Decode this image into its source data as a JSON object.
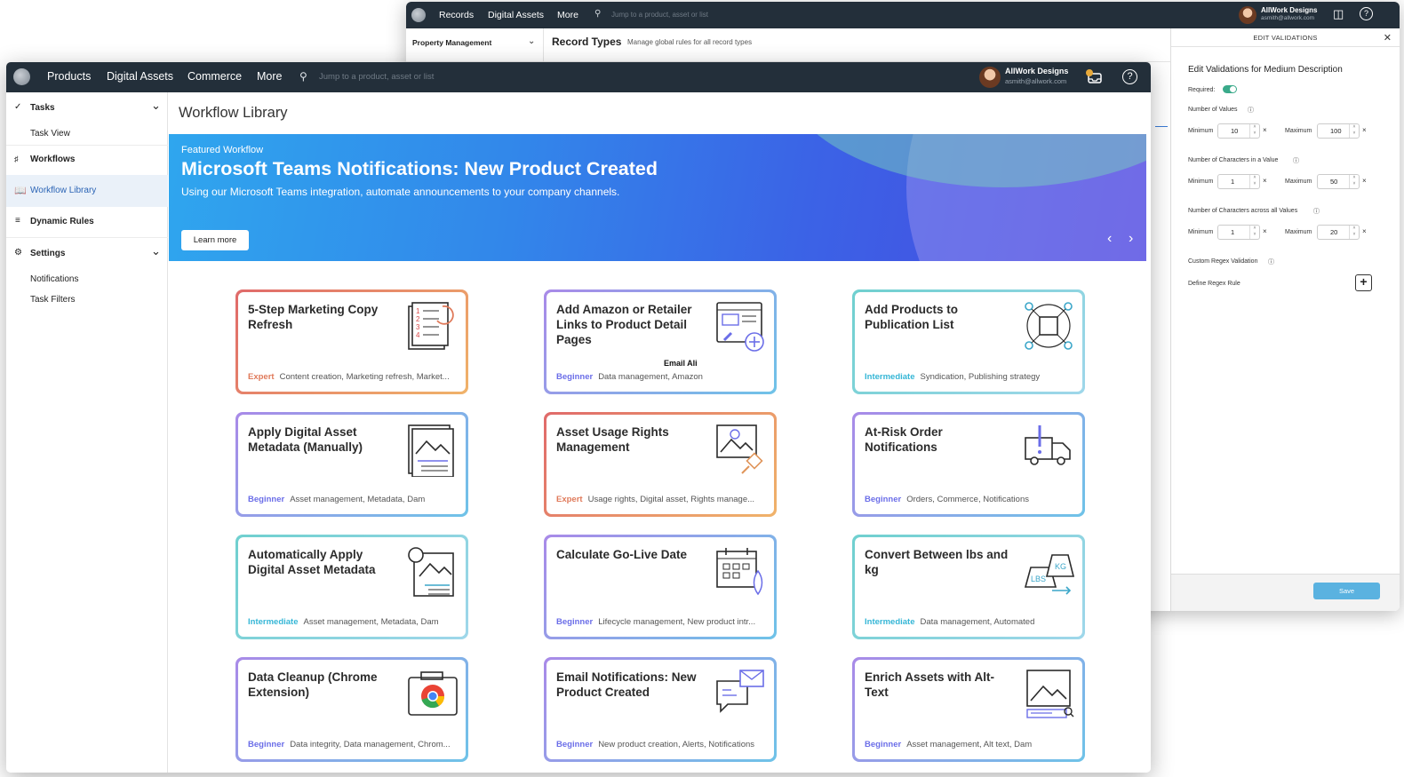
{
  "back_window": {
    "nav": {
      "records": "Records",
      "digital_assets": "Digital Assets",
      "more": "More",
      "search_placeholder": "Jump to a product, asset or list"
    },
    "user": {
      "name": "AllWork Designs",
      "email": "asmith@allwork.com"
    },
    "dropdown": "Property Management",
    "page_title": "Record Types",
    "page_subtitle": "Manage global rules for all record types",
    "panel": {
      "header": "EDIT VALIDATIONS",
      "title": "Edit Validations for Medium Description",
      "required_label": "Required:",
      "sections": [
        {
          "label": "Number of Values",
          "min_label": "Minimum",
          "min": "10",
          "max_label": "Maximum",
          "max": "100"
        },
        {
          "label": "Number of Characters in a Value",
          "min_label": "Minimum",
          "min": "1",
          "max_label": "Maximum",
          "max": "50"
        },
        {
          "label": "Number of Characters across all Values",
          "min_label": "Minimum",
          "min": "1",
          "max_label": "Maximum",
          "max": "20"
        }
      ],
      "custom_regex": "Custom Regex Validation",
      "define_rule": "Define Regex Rule",
      "save": "Save"
    }
  },
  "front_window": {
    "nav": {
      "products": "Products",
      "digital_assets": "Digital Assets",
      "commerce": "Commerce",
      "more": "More",
      "search_placeholder": "Jump to a product, asset or list"
    },
    "user": {
      "name": "AllWork Designs",
      "email": "asmith@allwork.com"
    },
    "sidebar": {
      "tasks": "Tasks",
      "task_view": "Task View",
      "workflows": "Workflows",
      "workflow_library": "Workflow Library",
      "dynamic_rules": "Dynamic Rules",
      "settings": "Settings",
      "notifications": "Notifications",
      "task_filters": "Task Filters"
    },
    "page_title": "Workflow Library",
    "banner": {
      "eyebrow": "Featured Workflow",
      "title": "Microsoft Teams Notifications: New Product Created",
      "subtitle": "Using our Microsoft Teams integration, automate announcements to your company channels.",
      "cta": "Learn more"
    },
    "cursor_label": "Email Ali",
    "cards": [
      {
        "title": "5-Step Marketing Copy Refresh",
        "level": "Expert",
        "tags": "Content creation, Marketing refresh, Market...",
        "icon": "numbered-list-icon"
      },
      {
        "title": "Add Amazon or Retailer Links to Product Detail Pages",
        "level": "Beginner",
        "tags": "Data management, Amazon",
        "icon": "web-link-icon"
      },
      {
        "title": "Add Products to Publication List",
        "level": "Intermediate",
        "tags": "Syndication, Publishing strategy",
        "icon": "network-box-icon"
      },
      {
        "title": "Apply Digital Asset Metadata (Manually)",
        "level": "Beginner",
        "tags": "Asset management, Metadata, Dam",
        "icon": "image-document-icon"
      },
      {
        "title": "Asset Usage Rights Management",
        "level": "Expert",
        "tags": "Usage rights, Digital asset, Rights manage...",
        "icon": "image-gavel-icon"
      },
      {
        "title": "At-Risk Order Notifications",
        "level": "Beginner",
        "tags": "Orders, Commerce, Notifications",
        "icon": "truck-alert-icon"
      },
      {
        "title": "Automatically Apply Digital Asset Metadata",
        "level": "Intermediate",
        "tags": "Asset management, Metadata, Dam",
        "icon": "gear-image-icon"
      },
      {
        "title": "Calculate Go-Live Date",
        "level": "Beginner",
        "tags": "Lifecycle management, New product intr...",
        "icon": "calendar-rocket-icon"
      },
      {
        "title": "Convert Between lbs and kg",
        "level": "Intermediate",
        "tags": "Data management, Automated",
        "icon": "weights-icon"
      },
      {
        "title": "Data Cleanup (Chrome Extension)",
        "level": "Beginner",
        "tags": "Data integrity, Data management, Chrom...",
        "icon": "chrome-icon"
      },
      {
        "title": "Email Notifications: New Product Created",
        "level": "Beginner",
        "tags": "New product creation, Alerts, Notifications",
        "icon": "email-chat-icon"
      },
      {
        "title": "Enrich Assets with Alt-Text",
        "level": "Beginner",
        "tags": "Asset management, Alt text, Dam",
        "icon": "image-search-icon"
      }
    ]
  }
}
